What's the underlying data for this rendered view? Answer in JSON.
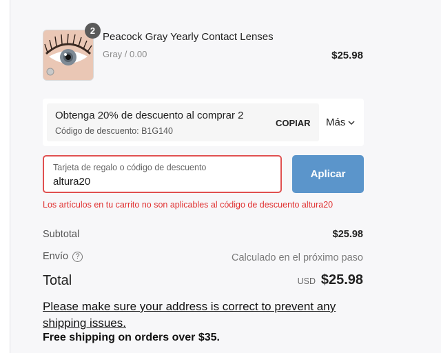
{
  "product": {
    "quantity": "2",
    "name": "Peacock Gray Yearly Contact Lenses",
    "variant": "Gray / 0.00",
    "price": "$25.98"
  },
  "promo": {
    "title": "Obtenga 20% de descuento al comprar 2",
    "code_text": "Código de descuento: B1G140",
    "copy_label": "COPIAR",
    "more_label": "Más"
  },
  "discount": {
    "label": "Tarjeta de regalo o código de descuento",
    "value": "altura20",
    "apply_label": "Aplicar",
    "error": "Los artículos en tu carrito no son aplicables al código de descuento altura20"
  },
  "summary": {
    "subtotal_label": "Subtotal",
    "subtotal_value": "$25.98",
    "shipping_label": "Envío",
    "shipping_value": "Calculado en el próximo paso",
    "total_label": "Total",
    "currency": "USD",
    "total_value": "$25.98"
  },
  "notice": {
    "address_text": "Please make sure your address is correct to prevent any shipping issues.",
    "free_shipping": "Free shipping on orders over $35."
  },
  "colors": {
    "accent": "#5b95cb",
    "error": "#e03030"
  },
  "icons": [
    "help-icon",
    "chevron-down-icon",
    "eye-lens-icon"
  ]
}
